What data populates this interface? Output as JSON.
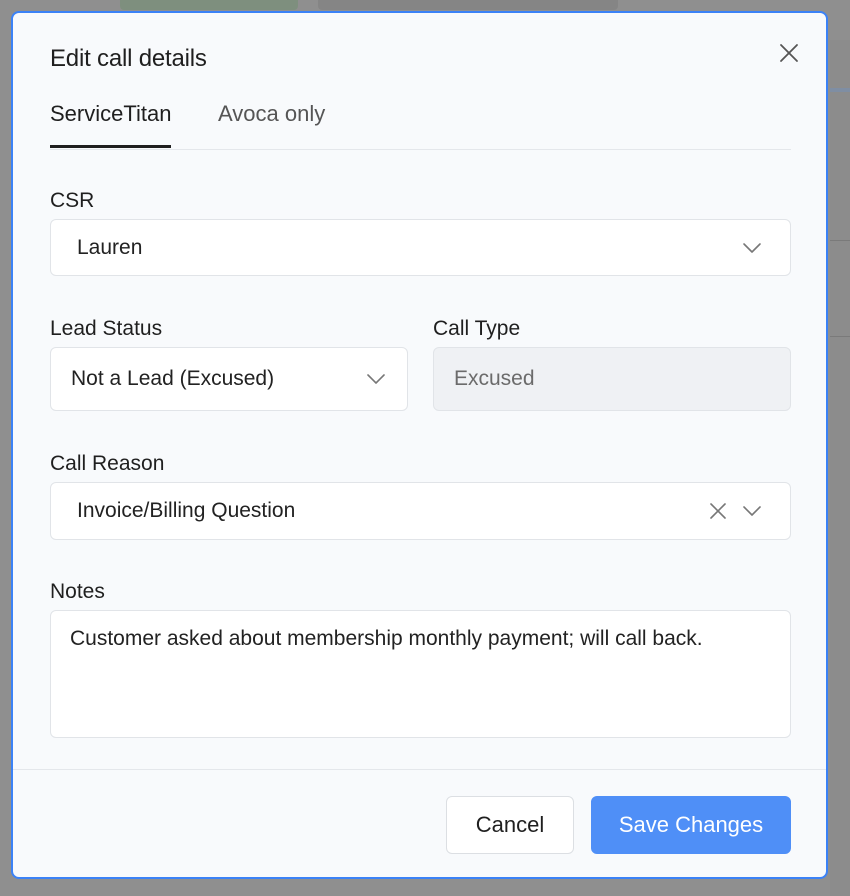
{
  "modal": {
    "title": "Edit call details",
    "tabs": [
      {
        "label": "ServiceTitan",
        "active": true
      },
      {
        "label": "Avoca only",
        "active": false
      }
    ],
    "csr": {
      "label": "CSR",
      "value": "Lauren"
    },
    "lead_status": {
      "label": "Lead Status",
      "value": "Not a Lead (Excused)"
    },
    "call_type": {
      "label": "Call Type",
      "value": "Excused"
    },
    "call_reason": {
      "label": "Call Reason",
      "value": "Invoice/Billing Question"
    },
    "notes": {
      "label": "Notes",
      "value": "Customer asked about membership monthly payment; will call back."
    },
    "buttons": {
      "cancel": "Cancel",
      "save": "Save Changes"
    }
  },
  "icons": {
    "close": "close-icon",
    "chevron": "chevron-down-icon",
    "clear": "clear-icon"
  },
  "colors": {
    "accent": "#3b82f6",
    "primary_button": "#4f8ff7",
    "disabled_bg": "#eff1f4"
  }
}
